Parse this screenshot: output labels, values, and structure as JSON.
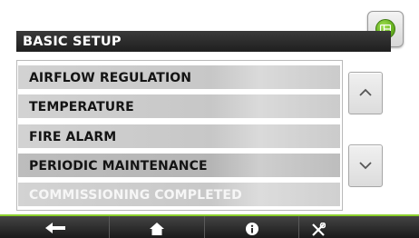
{
  "header": {
    "title": "BASIC SETUP"
  },
  "menu": {
    "items": [
      {
        "label": "AIRFLOW REGULATION",
        "state": "normal"
      },
      {
        "label": "TEMPERATURE",
        "state": "normal"
      },
      {
        "label": "FIRE ALARM",
        "state": "normal"
      },
      {
        "label": "PERIODIC MAINTENANCE",
        "state": "selected"
      },
      {
        "label": "COMMISSIONING COMPLETED",
        "state": "disabled"
      }
    ]
  },
  "icons": {
    "home": "green-home-icon",
    "scroll_up": "chevron-up-icon",
    "scroll_down": "chevron-down-icon",
    "back": "back-arrow-icon",
    "house": "house-icon",
    "info": "info-icon",
    "settings": "tools-icon"
  },
  "colors": {
    "accent": "#8ccf2c",
    "header_bg": "#1f1f1f",
    "item_bg": "#c9c9c9",
    "item_text": "#141414",
    "disabled_text": "#f6f6f6"
  }
}
